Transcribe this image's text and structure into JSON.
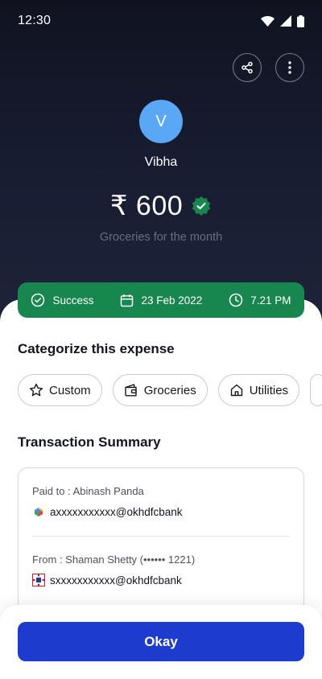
{
  "status_bar": {
    "time": "12:30",
    "icons": [
      "wifi-icon",
      "signal-icon",
      "battery-icon"
    ]
  },
  "header": {
    "actions": [
      "share-icon",
      "more-vertical-icon"
    ]
  },
  "payee": {
    "avatar_initial": "V",
    "name": "Vibha"
  },
  "amount": {
    "value": "₹ 600",
    "verified_icon": "verified-check-icon",
    "note": "Groceries for the month"
  },
  "status_strip": {
    "status": "Success",
    "date": "23 Feb 2022",
    "time": "7.21 PM",
    "color": "#17874f"
  },
  "categorize": {
    "title": "Categorize this expense",
    "chips": [
      {
        "label": "Custom",
        "icon": "star-icon"
      },
      {
        "label": "Groceries",
        "icon": "wallet-icon"
      },
      {
        "label": "Utilities",
        "icon": "home-icon"
      }
    ]
  },
  "summary": {
    "title": "Transaction Summary",
    "paid_to_label": "Paid to : Abinash Panda",
    "paid_to_id": "axxxxxxxxxxx@okhdfcbank",
    "paid_to_icon": "upi-app-icon",
    "from_label": "From : Shaman Shetty (•••••• 1221)",
    "from_id": "sxxxxxxxxxxx@okhdfcbank",
    "from_icon": "hdfc-bank-icon"
  },
  "footer": {
    "okay_label": "Okay",
    "accent": "#1d3bcc"
  }
}
